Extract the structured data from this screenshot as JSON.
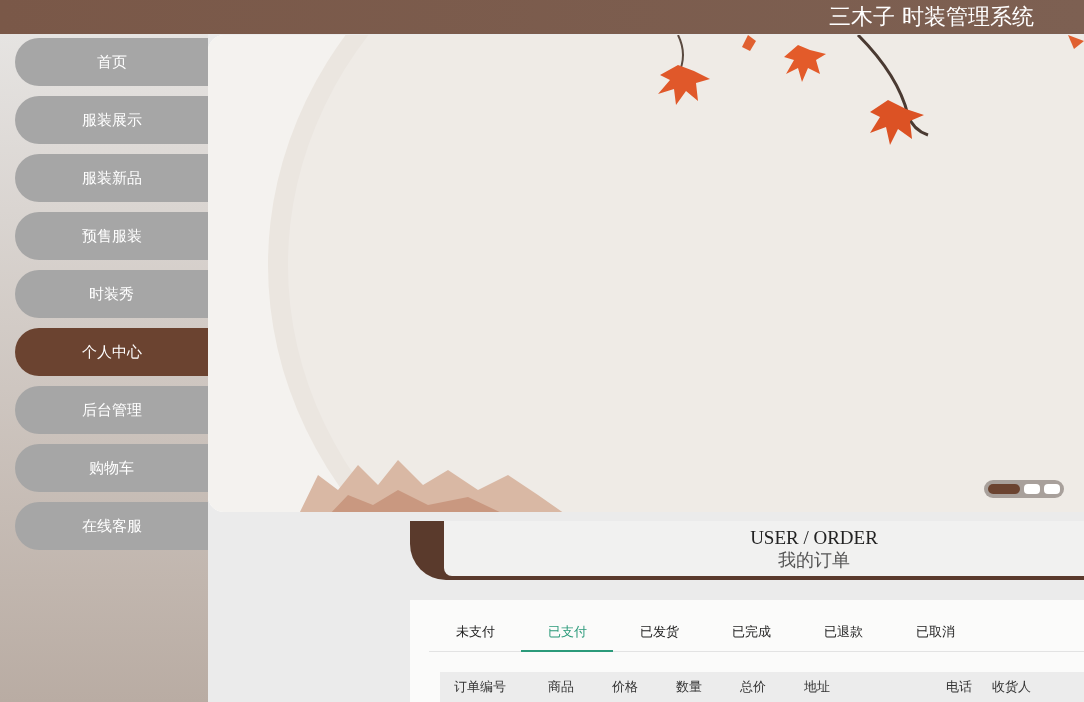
{
  "header": {
    "title": "三木子 时装管理系统"
  },
  "nav": [
    {
      "label": "首页",
      "selected": false
    },
    {
      "label": "服装展示",
      "selected": false
    },
    {
      "label": "服装新品",
      "selected": false
    },
    {
      "label": "预售服装",
      "selected": false
    },
    {
      "label": "时装秀",
      "selected": false
    },
    {
      "label": "个人中心",
      "selected": true
    },
    {
      "label": "后台管理",
      "selected": false
    },
    {
      "label": "购物车",
      "selected": false
    },
    {
      "label": "在线客服",
      "selected": false
    }
  ],
  "banner": {
    "dots": [
      {
        "selected": true
      },
      {
        "selected": false
      },
      {
        "selected": false
      }
    ]
  },
  "section": {
    "title": "USER / ORDER",
    "subtitle": "我的订单"
  },
  "tabs": [
    {
      "label": "未支付",
      "selected": false
    },
    {
      "label": "已支付",
      "selected": true
    },
    {
      "label": "已发货",
      "selected": false
    },
    {
      "label": "已完成",
      "selected": false
    },
    {
      "label": "已退款",
      "selected": false
    },
    {
      "label": "已取消",
      "selected": false
    }
  ],
  "table": {
    "columns": [
      "订单编号",
      "商品",
      "价格",
      "数量",
      "总价",
      "地址",
      "电话",
      "收货人"
    ]
  }
}
